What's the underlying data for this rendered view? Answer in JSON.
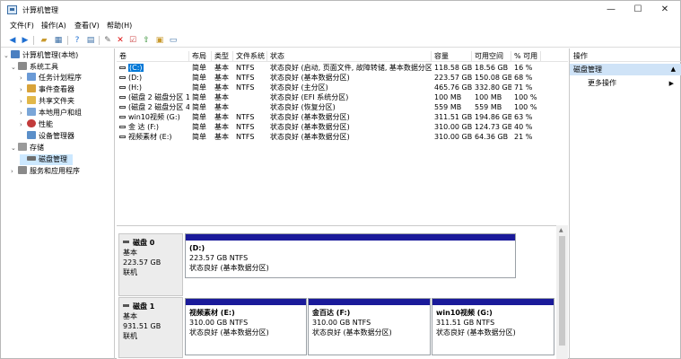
{
  "window": {
    "title": "计算机管理",
    "minimize": "—",
    "maximize": "☐",
    "close": "✕"
  },
  "menu": [
    "文件(F)",
    "操作(A)",
    "查看(V)",
    "帮助(H)"
  ],
  "tree": {
    "root": "计算机管理(本地)",
    "system_tools": "系统工具",
    "task_scheduler": "任务计划程序",
    "event_viewer": "事件查看器",
    "shared_folders": "共享文件夹",
    "local_users": "本地用户和组",
    "performance": "性能",
    "device_manager": "设备管理器",
    "storage": "存储",
    "disk_management": "磁盘管理",
    "services": "服务和应用程序"
  },
  "volume_headers": [
    "卷",
    "布局",
    "类型",
    "文件系统",
    "状态",
    "容量",
    "可用空间",
    "% 可用"
  ],
  "volumes": [
    [
      "(C:)",
      "简单",
      "基本",
      "NTFS",
      "状态良好 (启动, 页面文件, 故障转储, 基本数据分区)",
      "118.58 GB",
      "18.56 GB",
      "16 %"
    ],
    [
      "(D:)",
      "简单",
      "基本",
      "NTFS",
      "状态良好 (基本数据分区)",
      "223.57 GB",
      "150.08 GB",
      "68 %"
    ],
    [
      "(H:)",
      "简单",
      "基本",
      "NTFS",
      "状态良好 (主分区)",
      "465.76 GB",
      "332.80 GB",
      "71 %"
    ],
    [
      "(磁盘 2 磁盘分区 1)",
      "简单",
      "基本",
      "",
      "状态良好 (EFI 系统分区)",
      "100 MB",
      "100 MB",
      "100 %"
    ],
    [
      "(磁盘 2 磁盘分区 4)",
      "简单",
      "基本",
      "",
      "状态良好 (恢复分区)",
      "559 MB",
      "559 MB",
      "100 %"
    ],
    [
      "win10视频 (G:)",
      "简单",
      "基本",
      "NTFS",
      "状态良好 (基本数据分区)",
      "311.51 GB",
      "194.86 GB",
      "63 %"
    ],
    [
      "金   达 (F:)",
      "简单",
      "基本",
      "NTFS",
      "状态良好 (基本数据分区)",
      "310.00 GB",
      "124.73 GB",
      "40 %"
    ],
    [
      "视频素材 (E:)",
      "简单",
      "基本",
      "NTFS",
      "状态良好 (基本数据分区)",
      "310.00 GB",
      "64.36 GB",
      "21 %"
    ]
  ],
  "disks": [
    {
      "name": "磁盘 0",
      "type": "基本",
      "size": "223.57 GB",
      "status": "联机",
      "partitions": [
        {
          "name": "(D:)",
          "detail": "223.57 GB NTFS",
          "status": "状态良好 (基本数据分区)"
        }
      ]
    },
    {
      "name": "磁盘 1",
      "type": "基本",
      "size": "931.51 GB",
      "status": "联机",
      "partitions": [
        {
          "name": "视频素材  (E:)",
          "detail": "310.00 GB NTFS",
          "status": "状态良好 (基本数据分区)"
        },
        {
          "name": "金百达  (F:)",
          "detail": "310.00 GB NTFS",
          "status": "状态良好 (基本数据分区)"
        },
        {
          "name": "win10视频  (G:)",
          "detail": "311.51 GB NTFS",
          "status": "状态良好 (基本数据分区)"
        }
      ]
    }
  ],
  "actions": {
    "header": "操作",
    "section": "磁盘管理",
    "more": "更多操作"
  },
  "colors": {
    "partition_bar": "#1a1a9a",
    "selection": "#0078d7",
    "tree_selection": "#cce8ff",
    "section": "#cfe3f7"
  }
}
